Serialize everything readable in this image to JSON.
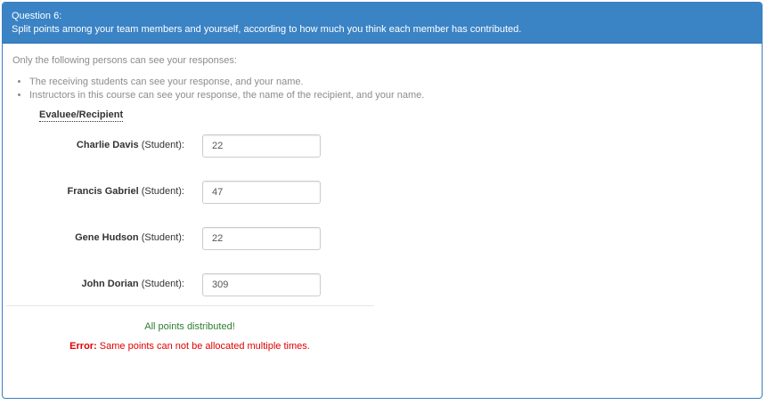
{
  "question": {
    "number_label": "Question 6:",
    "text": "Split points among your team members and yourself, according to how much you think each member has contributed."
  },
  "visibility": {
    "intro": "Only the following persons can see your responses:",
    "items": [
      "The receiving students can see your response, and your name.",
      "Instructors in this course can see your response, the name of the recipient, and your name."
    ]
  },
  "evaluee_header": "Evaluee/Recipient",
  "recipients": [
    {
      "name": "Charlie Davis",
      "role": "(Student):",
      "points": "22"
    },
    {
      "name": "Francis Gabriel",
      "role": "(Student):",
      "points": "47"
    },
    {
      "name": "Gene Hudson",
      "role": "(Student):",
      "points": "22"
    },
    {
      "name": "John Dorian",
      "role": "(Student):",
      "points": "309"
    }
  ],
  "messages": {
    "distributed": "All points distributed!",
    "error_label": "Error:",
    "error_text": " Same points can not be allocated multiple times."
  },
  "colors": {
    "header_bg": "#3a83c5",
    "success": "#2e7d32",
    "error": "#e00000"
  }
}
